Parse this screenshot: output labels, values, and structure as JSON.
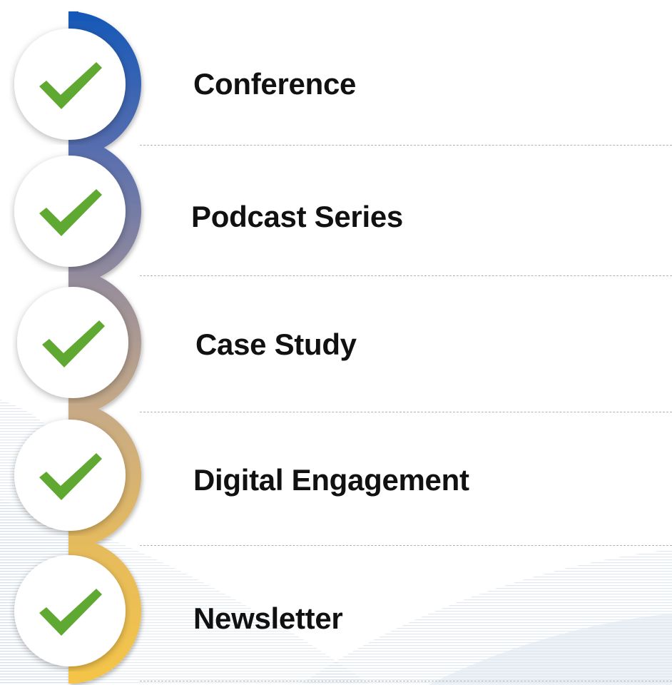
{
  "items": [
    {
      "label": "Conference",
      "checked": true
    },
    {
      "label": "Podcast Series",
      "checked": true
    },
    {
      "label": "Case Study",
      "checked": true
    },
    {
      "label": "Digital Engagement",
      "checked": true
    },
    {
      "label": "Newsletter",
      "checked": true
    }
  ],
  "colors": {
    "spine_gradient": [
      "#1257b8",
      "#5a6fae",
      "#9a8f9a",
      "#c8ab86",
      "#e6bb5c",
      "#f5c548"
    ],
    "check": "#5fa832",
    "badge_fill": "#ffffff",
    "divider": "#b3b3b3",
    "label_text": "#111111",
    "background_pattern": "#dde6ef"
  },
  "icons": {
    "badge": "check-icon"
  }
}
